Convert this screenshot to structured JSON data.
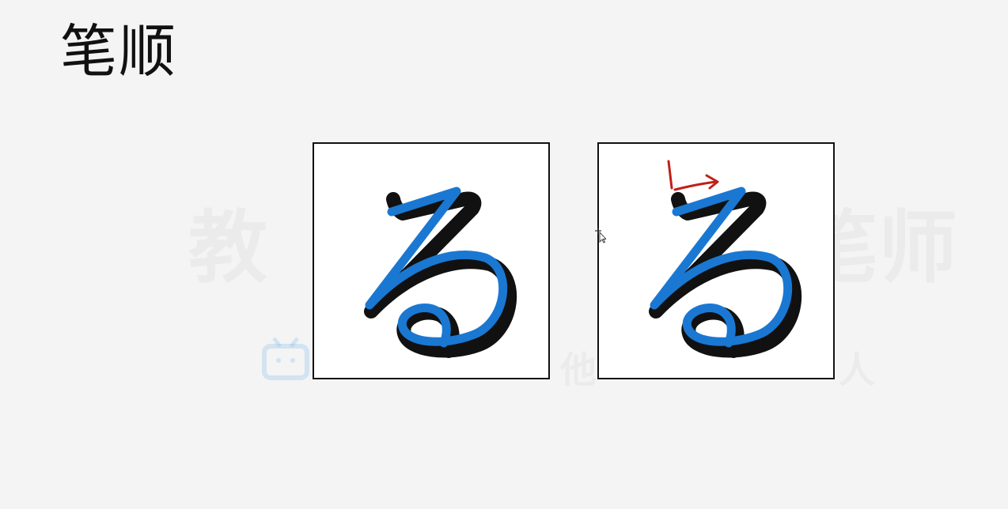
{
  "heading": {
    "title": "笔顺"
  },
  "watermark": {
    "big_left": "教",
    "big_right": "笔师",
    "small_left": "他",
    "small_right": "人"
  },
  "panels": [
    {
      "glyph": "ろ",
      "shows_direction_arrow": false
    },
    {
      "glyph": "ろ",
      "shows_direction_arrow": true
    }
  ],
  "colors": {
    "background": "#f4f4f4",
    "stroke_blue": "#1a78d2",
    "stroke_shadow": "#111111",
    "arrow_red": "#c0201a",
    "panel_border": "#111111"
  },
  "icons": {
    "cursor": "cursor-move-icon",
    "watermark_logo": "tv-logo-icon"
  }
}
